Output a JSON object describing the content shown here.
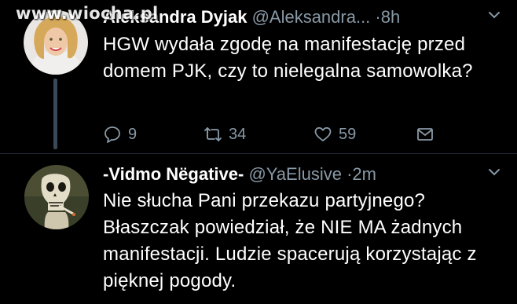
{
  "watermark": "www.wiocha.pl",
  "tweets": [
    {
      "name": "Aleksandra Dyjak",
      "handle": "@Aleksandra...",
      "dot": "·",
      "time": "8h",
      "text": "HGW wydała zgodę na manifestację przed domem PJK, czy to nielegalna samowolka?",
      "replies": "9",
      "retweets": "34",
      "likes": "59"
    },
    {
      "name": "-Vidmo Nëgative-",
      "handle": "@YaElusive",
      "dot": "·",
      "time": "2m",
      "text": "Nie słucha Pani przekazu partyjnego? Błaszczak powiedział, że NIE MA żadnych manifestacji. Ludzie spacerują korzystając z pięknej pogody."
    }
  ],
  "icons": {
    "reply": "reply-icon",
    "retweet": "retweet-icon",
    "like": "heart-icon",
    "dm": "envelope-icon",
    "caret": "chevron-down-icon"
  },
  "colors": {
    "background": "#000000",
    "secondary_text": "#8899a6",
    "thread_line": "#394957"
  }
}
